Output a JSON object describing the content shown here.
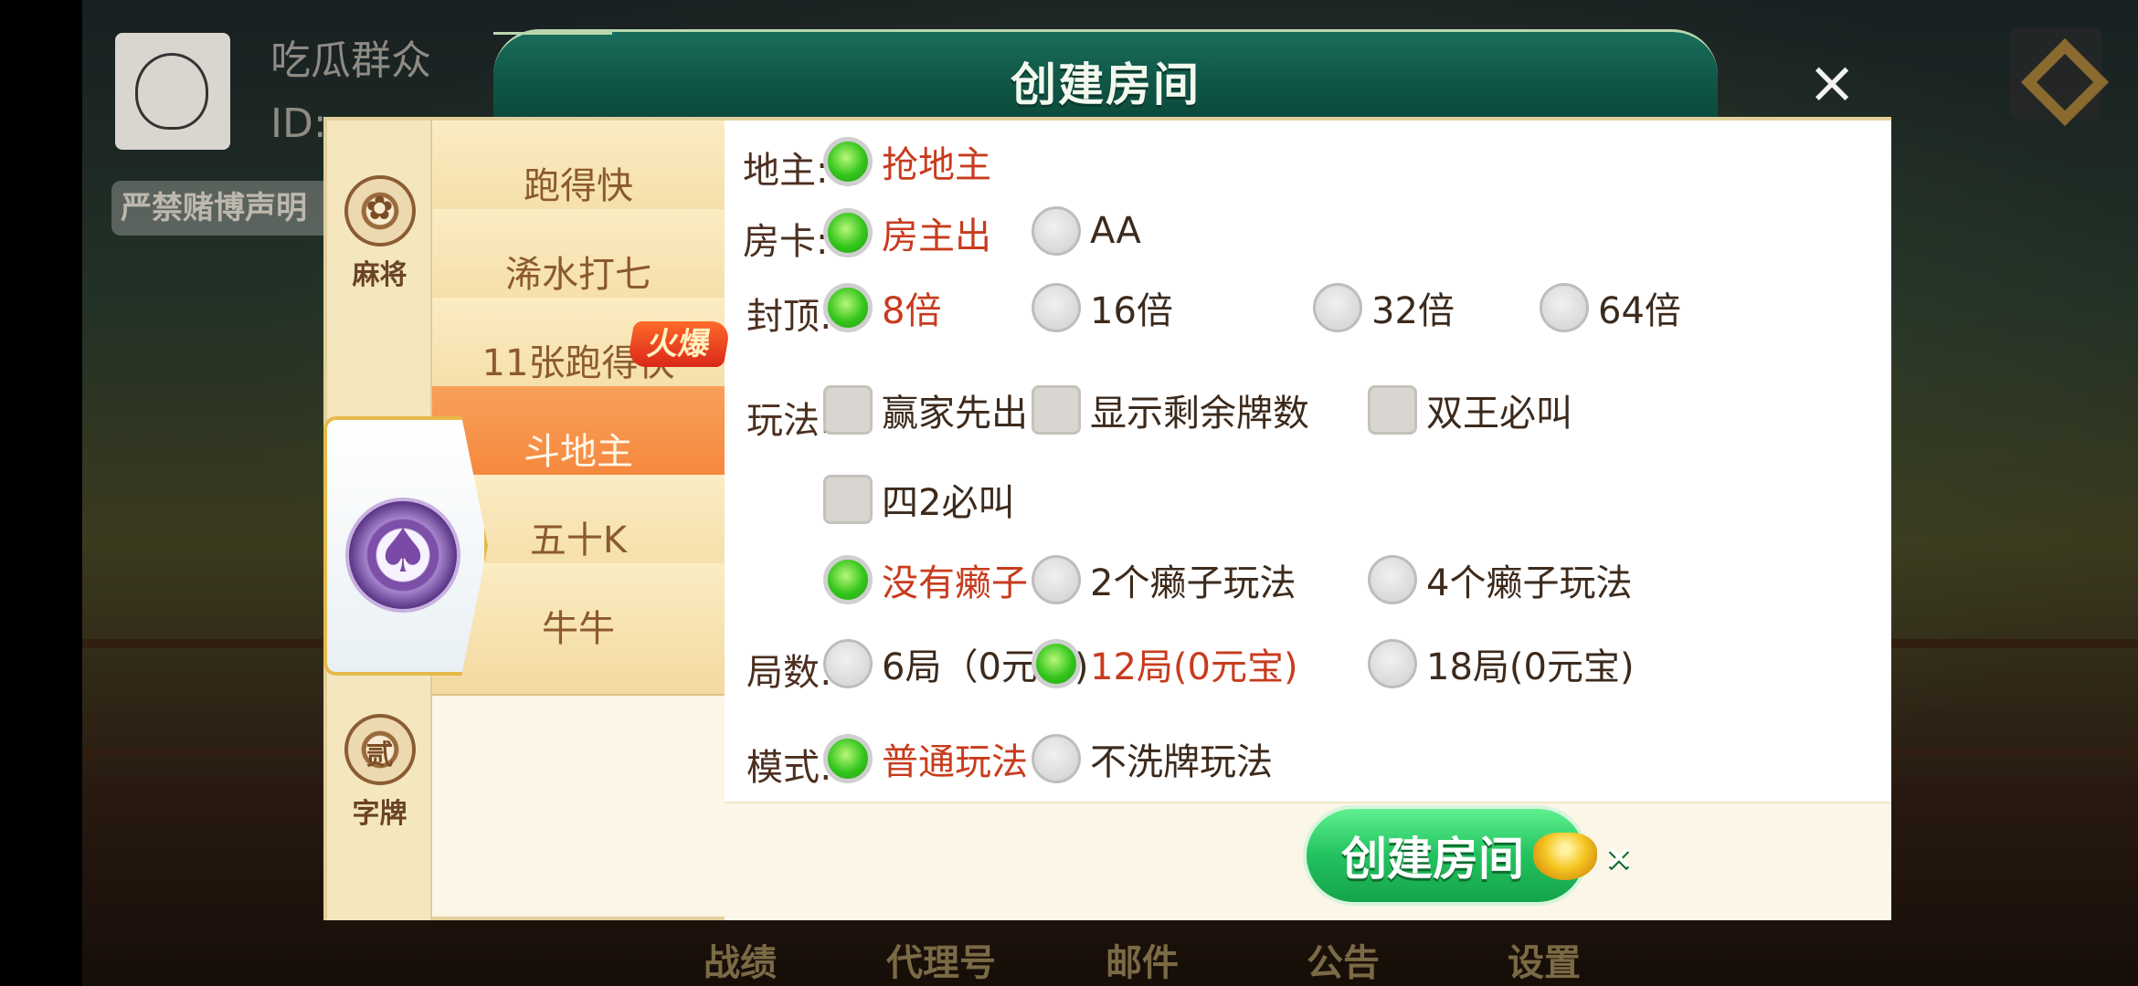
{
  "background": {
    "player_name": "吃瓜群众",
    "player_id": "ID:",
    "notice": "严禁赌博声明",
    "bottom_nav": [
      "战绩",
      "代理号",
      "邮件",
      "公告",
      "设置"
    ]
  },
  "dialog": {
    "title": "创建房间",
    "close_label": "×"
  },
  "categories": [
    {
      "label": "麻将",
      "icon": "mahjong-icon",
      "glyph": "✿"
    },
    {
      "label": "字牌",
      "icon": "zipai-icon",
      "glyph": "贰"
    }
  ],
  "poker_icon": {
    "icon": "spade-chip-icon",
    "glyph": "♠"
  },
  "games": [
    {
      "label": "跑得快"
    },
    {
      "label": "浠水打七"
    },
    {
      "label": "11张跑得快"
    },
    {
      "label": "斗地主",
      "active": true
    },
    {
      "label": "五十K"
    },
    {
      "label": "牛牛"
    }
  ],
  "hot_badge": "火爆",
  "options": {
    "dizhu": {
      "label": "地主:",
      "choices": [
        "抢地主"
      ],
      "selected": "抢地主"
    },
    "fangka": {
      "label": "房卡:",
      "choices": [
        "房主出",
        "AA"
      ],
      "selected": "房主出"
    },
    "fengding": {
      "label": "封顶:",
      "choices": [
        "8倍",
        "16倍",
        "32倍",
        "64倍"
      ],
      "selected": "8倍"
    },
    "wanfa": {
      "label": "玩法:",
      "checks": [
        "赢家先出",
        "显示剩余牌数",
        "双王必叫",
        "四2必叫"
      ]
    },
    "laizi": {
      "choices": [
        "没有癞子",
        "2个癞子玩法",
        "4个癞子玩法"
      ],
      "selected": "没有癞子"
    },
    "jushu": {
      "label": "局数:",
      "choices": [
        "6局（0元宝)",
        "12局(0元宝)",
        "18局(0元宝)"
      ],
      "selected": "12局(0元宝)"
    },
    "moshi": {
      "label": "模式:",
      "choices": [
        "普通玩法",
        "不洗牌玩法"
      ],
      "selected": "普通玩法"
    }
  },
  "create_button": {
    "label": "创建房间",
    "cost_suffix": "×"
  },
  "colors": {
    "header": "#0f5545",
    "selected_text": "#c83b1d",
    "radio_on": "#33c51b",
    "active_tab": "#f37e30"
  }
}
